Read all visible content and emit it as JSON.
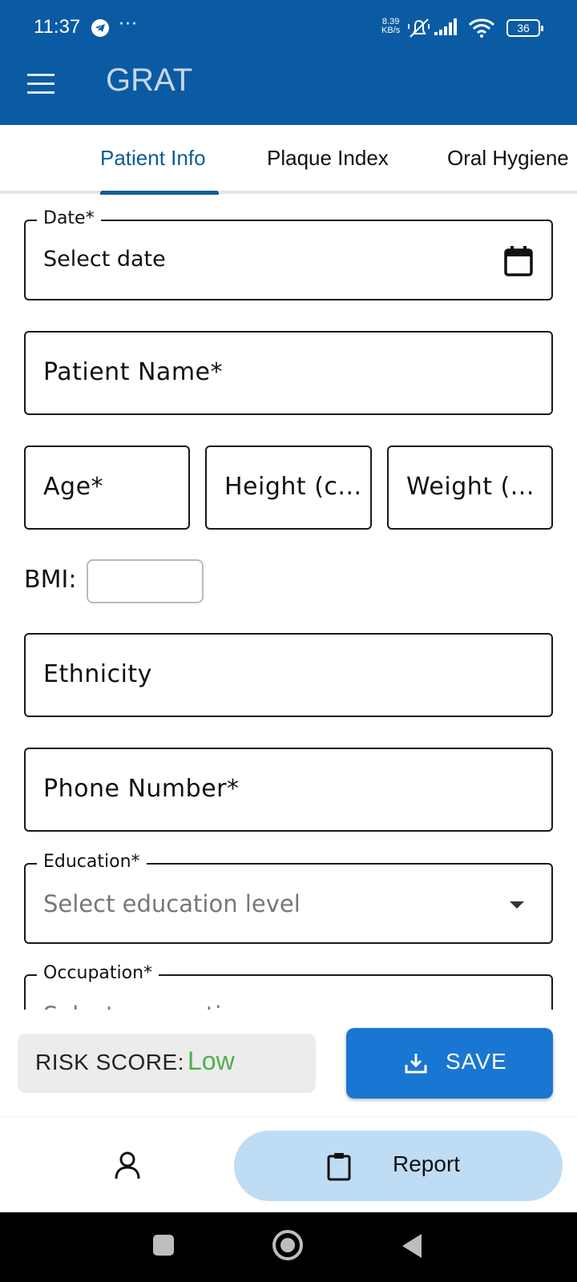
{
  "status_bar": {
    "time": "11:37",
    "dots": "···",
    "net_speed_value": "8.39",
    "net_speed_unit": "KB/s",
    "battery": "36"
  },
  "app_bar": {
    "title": "GRAT"
  },
  "tabs": [
    {
      "label": "Patient Info",
      "active": true
    },
    {
      "label": "Plaque Index",
      "active": false
    },
    {
      "label": "Oral Hygiene",
      "active": false
    }
  ],
  "form": {
    "date": {
      "label": "Date*",
      "placeholder": "Select date"
    },
    "patient_name": {
      "placeholder": "Patient Name*"
    },
    "age": {
      "placeholder": "Age*"
    },
    "height": {
      "placeholder": "Height (c..."
    },
    "weight": {
      "placeholder": "Weight (..."
    },
    "bmi": {
      "label": "BMI:",
      "value": ""
    },
    "ethnicity": {
      "placeholder": "Ethnicity"
    },
    "phone": {
      "placeholder": "Phone Number*"
    },
    "education": {
      "label": "Education*",
      "placeholder": "Select education level"
    },
    "occupation": {
      "label": "Occupation*",
      "placeholder": "Select occupation"
    }
  },
  "risk": {
    "label": "RISK SCORE:",
    "value": "Low",
    "value_color": "#4caf50"
  },
  "save_button": {
    "label": "SAVE",
    "color": "#1976d2"
  },
  "bottom_nav": {
    "report_label": "Report"
  },
  "colors": {
    "app_bar": "#0a5ba3",
    "active_tab": "#0d5c96",
    "report_pill": "#bfdcf5"
  },
  "icons": [
    "telegram-icon",
    "mute-icon",
    "signal-icon",
    "wifi-icon",
    "battery-icon",
    "menu-icon",
    "calendar-icon",
    "dropdown-arrow-icon",
    "download-icon",
    "person-icon",
    "clipboard-icon",
    "recents-icon",
    "home-icon",
    "back-icon"
  ]
}
